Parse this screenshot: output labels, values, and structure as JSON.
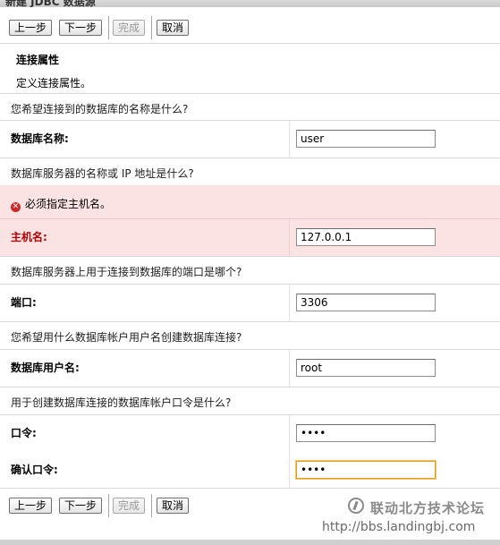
{
  "window": {
    "title": "新建 JDBC 数据源"
  },
  "toolbar": {
    "prev_label": "上一步",
    "next_label": "下一步",
    "finish_label": "完成",
    "cancel_label": "取消"
  },
  "header": {
    "title": "连接属性",
    "subtitle": "定义连接属性。"
  },
  "sections": {
    "db_name": {
      "question": "您希望连接到的数据库的名称是什么?",
      "label": "数据库名称:",
      "value": "user"
    },
    "host": {
      "question": "数据库服务器的名称或 IP 地址是什么?",
      "error": "必须指定主机名。",
      "label": "主机名:",
      "value": "127.0.0.1"
    },
    "port": {
      "question": "数据库服务器上用于连接到数据库的端口是哪个?",
      "label": "端口:",
      "value": "3306"
    },
    "user": {
      "question": "您希望用什么数据库帐户用户名创建数据库连接?",
      "label": "数据库用户名:",
      "value": "root"
    },
    "password": {
      "question": "用于创建数据库连接的数据库帐户口令是什么?",
      "label": "口令:",
      "value": "••••",
      "confirm_label": "确认口令:",
      "confirm_value": "••••"
    }
  },
  "watermark": {
    "title": "联动北方技术论坛",
    "url": "http://bbs.landingbj.com"
  },
  "colors": {
    "error_band": "#fbe3e4",
    "error_label": "#b30000",
    "focus_border": "#e0a020"
  }
}
